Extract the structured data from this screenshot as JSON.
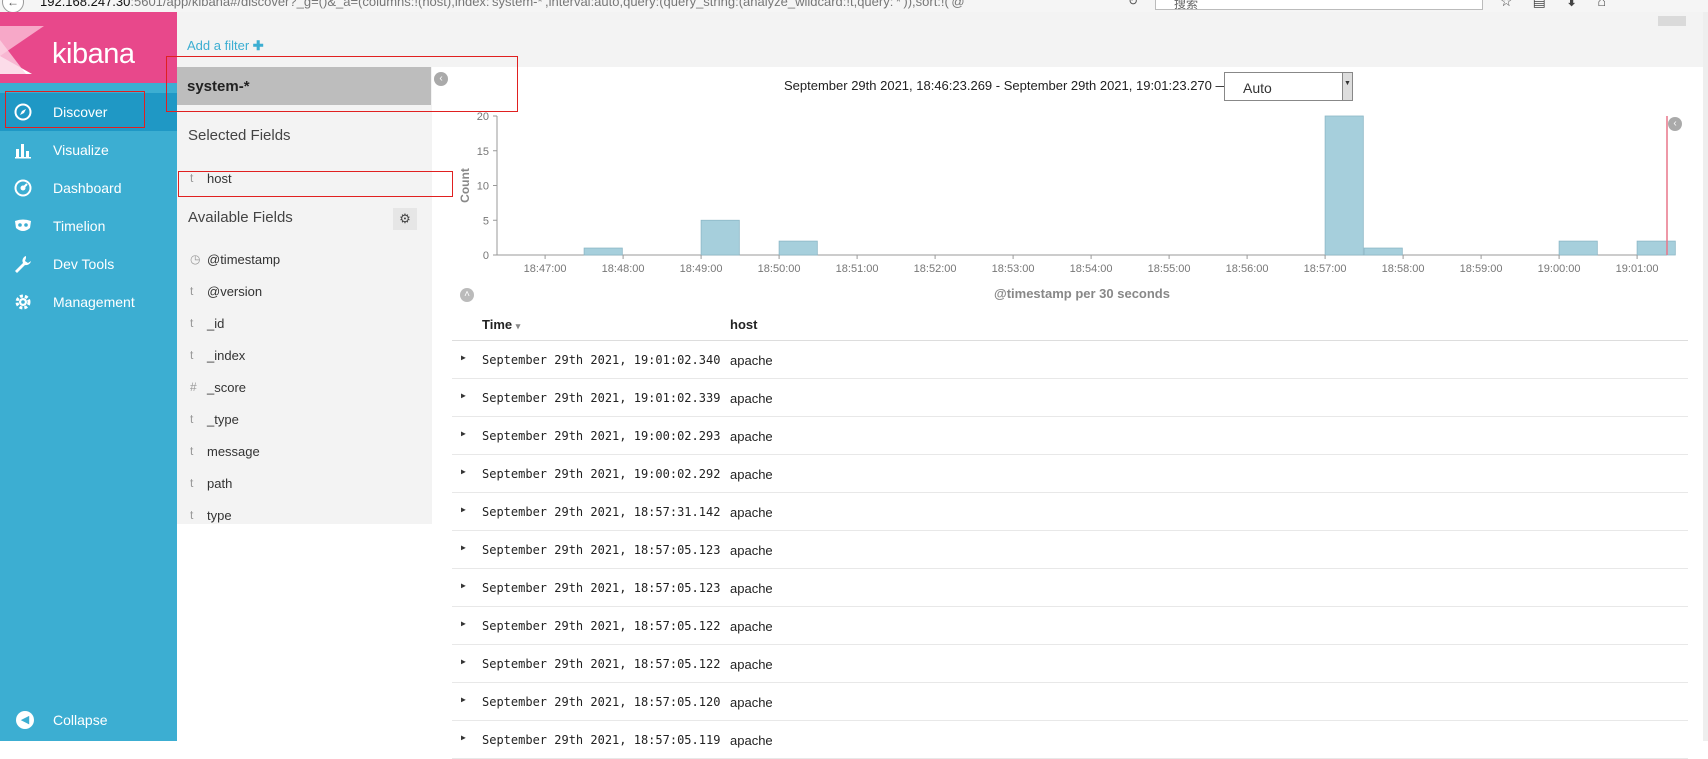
{
  "browser": {
    "url_host": "192.168.247.30",
    "url_rest": ":5601/app/kibana#/discover?_g=()&_a=(columns:!(host),index:'system-*',interval:auto,query:(query_string:(analyze_wildcard:!t,query:'*')),sort:!('@",
    "search_placeholder": "搜索"
  },
  "app": {
    "logo_text": "kibana"
  },
  "sidebar": {
    "items": [
      {
        "label": "Discover",
        "icon": "compass-icon"
      },
      {
        "label": "Visualize",
        "icon": "bar-chart-icon"
      },
      {
        "label": "Dashboard",
        "icon": "gauge-icon"
      },
      {
        "label": "Timelion",
        "icon": "mask-icon"
      },
      {
        "label": "Dev Tools",
        "icon": "wrench-icon"
      },
      {
        "label": "Management",
        "icon": "gear-icon"
      }
    ],
    "collapse_label": "Collapse"
  },
  "filter": {
    "add_label": "Add a filter",
    "plus": "✚"
  },
  "index_pattern": "system-*",
  "fields": {
    "selected_title": "Selected Fields",
    "selected": [
      {
        "type": "t",
        "name": "host"
      }
    ],
    "available_title": "Available Fields",
    "available": [
      {
        "type": "◷",
        "name": "@timestamp"
      },
      {
        "type": "t",
        "name": "@version"
      },
      {
        "type": "t",
        "name": "_id"
      },
      {
        "type": "t",
        "name": "_index"
      },
      {
        "type": "#",
        "name": "_score"
      },
      {
        "type": "t",
        "name": "_type"
      },
      {
        "type": "t",
        "name": "message"
      },
      {
        "type": "t",
        "name": "path"
      },
      {
        "type": "t",
        "name": "type"
      }
    ]
  },
  "time_range": "September 29th 2021, 18:46:23.269 - September 29th 2021, 19:01:23.270 —",
  "interval": {
    "selected": "Auto"
  },
  "chart_data": {
    "type": "bar",
    "ylabel": "Count",
    "xlabel": "@timestamp per 30 seconds",
    "ylim": [
      0,
      20
    ],
    "yticks": [
      0,
      5,
      10,
      15,
      20
    ],
    "xticks": [
      "18:47:00",
      "18:48:00",
      "18:49:00",
      "18:50:00",
      "18:51:00",
      "18:52:00",
      "18:53:00",
      "18:54:00",
      "18:55:00",
      "18:56:00",
      "18:57:00",
      "18:58:00",
      "18:59:00",
      "19:00:00",
      "19:01:00"
    ],
    "bars": [
      {
        "x": "18:47:30",
        "value": 1
      },
      {
        "x": "18:49:00",
        "value": 5
      },
      {
        "x": "18:50:00",
        "value": 2
      },
      {
        "x": "18:57:00",
        "value": 20
      },
      {
        "x": "18:57:30",
        "value": 1
      },
      {
        "x": "19:00:00",
        "value": 2
      },
      {
        "x": "19:01:00",
        "value": 2
      }
    ],
    "bar_color": "#a6cfdc",
    "now_marker": "19:01:23"
  },
  "table": {
    "columns": [
      "Time",
      "host"
    ],
    "sort_icon": "▾",
    "rows": [
      {
        "time": "September 29th 2021, 19:01:02.340",
        "host": "apache"
      },
      {
        "time": "September 29th 2021, 19:01:02.339",
        "host": "apache"
      },
      {
        "time": "September 29th 2021, 19:00:02.293",
        "host": "apache"
      },
      {
        "time": "September 29th 2021, 19:00:02.292",
        "host": "apache"
      },
      {
        "time": "September 29th 2021, 18:57:31.142",
        "host": "apache"
      },
      {
        "time": "September 29th 2021, 18:57:05.123",
        "host": "apache"
      },
      {
        "time": "September 29th 2021, 18:57:05.123",
        "host": "apache"
      },
      {
        "time": "September 29th 2021, 18:57:05.122",
        "host": "apache"
      },
      {
        "time": "September 29th 2021, 18:57:05.122",
        "host": "apache"
      },
      {
        "time": "September 29th 2021, 18:57:05.120",
        "host": "apache"
      },
      {
        "time": "September 29th 2021, 18:57:05.119",
        "host": "apache"
      }
    ]
  },
  "colors": {
    "sidebar": "#3caed2",
    "sidebar_active": "#1f98c5",
    "logo_bg": "#e8488b",
    "highlight": "#e02020"
  }
}
